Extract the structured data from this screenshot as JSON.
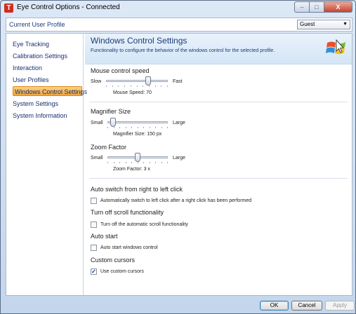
{
  "window": {
    "title": "Eye Control Options - Connected",
    "app_icon_letter": "T",
    "controls": {
      "minimize": "–",
      "maximize": "□",
      "close": "X"
    }
  },
  "profile_bar": {
    "label": "Current User Profile",
    "selected": "Guest",
    "arrow": "▼"
  },
  "sidebar": {
    "items": [
      {
        "label": "Eye Tracking",
        "active": false
      },
      {
        "label": "Calibration Settings",
        "active": false
      },
      {
        "label": "Interaction",
        "active": false
      },
      {
        "label": "User Profiles",
        "active": false
      },
      {
        "label": "Windows Control Settings",
        "active": true
      },
      {
        "label": "System Settings",
        "active": false
      },
      {
        "label": "System Information",
        "active": false
      }
    ]
  },
  "header": {
    "title": "Windows Control Settings",
    "description": "Functionality to configure the behavior of the windows control for the selected profile.",
    "logo_icon": "windows-logo-cursor-icon"
  },
  "mouse_speed": {
    "title": "Mouse control speed",
    "min_label": "Slow",
    "max_label": "Fast",
    "caption": "Mouse Speed: 70",
    "value_fraction": 0.7
  },
  "magnifier": {
    "title": "Magnifier Size",
    "min_label": "Small",
    "max_label": "Large",
    "caption": "Magnifier Size: 150 px",
    "value_fraction": 0.05
  },
  "zoom": {
    "title": "Zoom Factor",
    "min_label": "Small",
    "max_label": "Large",
    "caption": "Zoom Factor: 3 x",
    "value_fraction": 0.5
  },
  "auto_switch": {
    "title": "Auto switch from right to left click",
    "checkbox_label": "Automatically switch to left click after a right click has been performed",
    "checked": false
  },
  "scroll": {
    "title": "Turn off scroll functionality",
    "checkbox_label": "Turn off the automatic scroll functionality",
    "checked": false
  },
  "auto_start": {
    "title": "Auto start",
    "checkbox_label": "Auto start windows control",
    "checked": false
  },
  "custom_cursors": {
    "title": "Custom cursors",
    "checkbox_label": "Use custom cursors",
    "checked": true
  },
  "footer": {
    "ok": "OK",
    "cancel": "Cancel",
    "apply": "Apply"
  },
  "colors": {
    "active_nav": "#f1a33a",
    "nav_text": "#1c2f73",
    "header_bg": "#d4e5f6"
  }
}
